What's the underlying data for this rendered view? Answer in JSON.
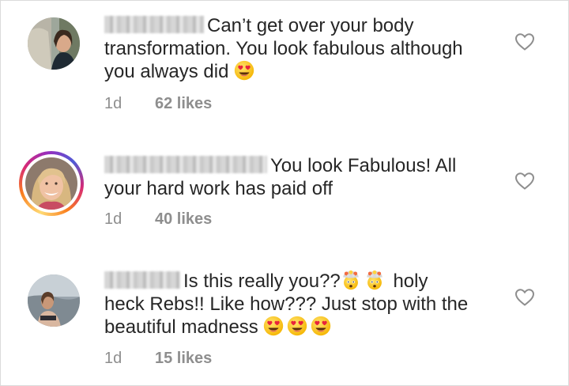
{
  "comments": [
    {
      "text_line1": "Can’t get over your body",
      "text_line2": "transformation. You look fabulous although",
      "text_line3": "you always did",
      "emojis": [
        "heart-eyes-emoji"
      ],
      "time": "1d",
      "likes": "62 likes"
    },
    {
      "text_line1": "You look Fabulous! All",
      "text_line2": "your hard work has paid off",
      "time": "1d",
      "likes": "40 likes"
    },
    {
      "text_line1a": "Is this really you??",
      "text_line1b": "holy",
      "text_line2": "heck Rebs!! Like how??? Just stop with the",
      "text_line3": "beautiful madness",
      "emojis_line1": [
        "exploding-head-emoji",
        "exploding-head-emoji"
      ],
      "emojis_line3": [
        "heart-eyes-emoji",
        "heart-eyes-emoji",
        "heart-eyes-emoji"
      ],
      "time": "1d",
      "likes": "15 likes"
    }
  ],
  "colors": {
    "text": "#262626",
    "meta": "#8e8e8e",
    "heart_outline": "#8e8e8e",
    "story_ring": [
      "#feda75",
      "#fa7e1e",
      "#d62976",
      "#962fbf"
    ]
  },
  "icons": {
    "like": "heart-outline-icon",
    "heart_eyes": "smiling-face-with-heart-eyes-emoji",
    "exploding_head": "exploding-head-emoji"
  }
}
